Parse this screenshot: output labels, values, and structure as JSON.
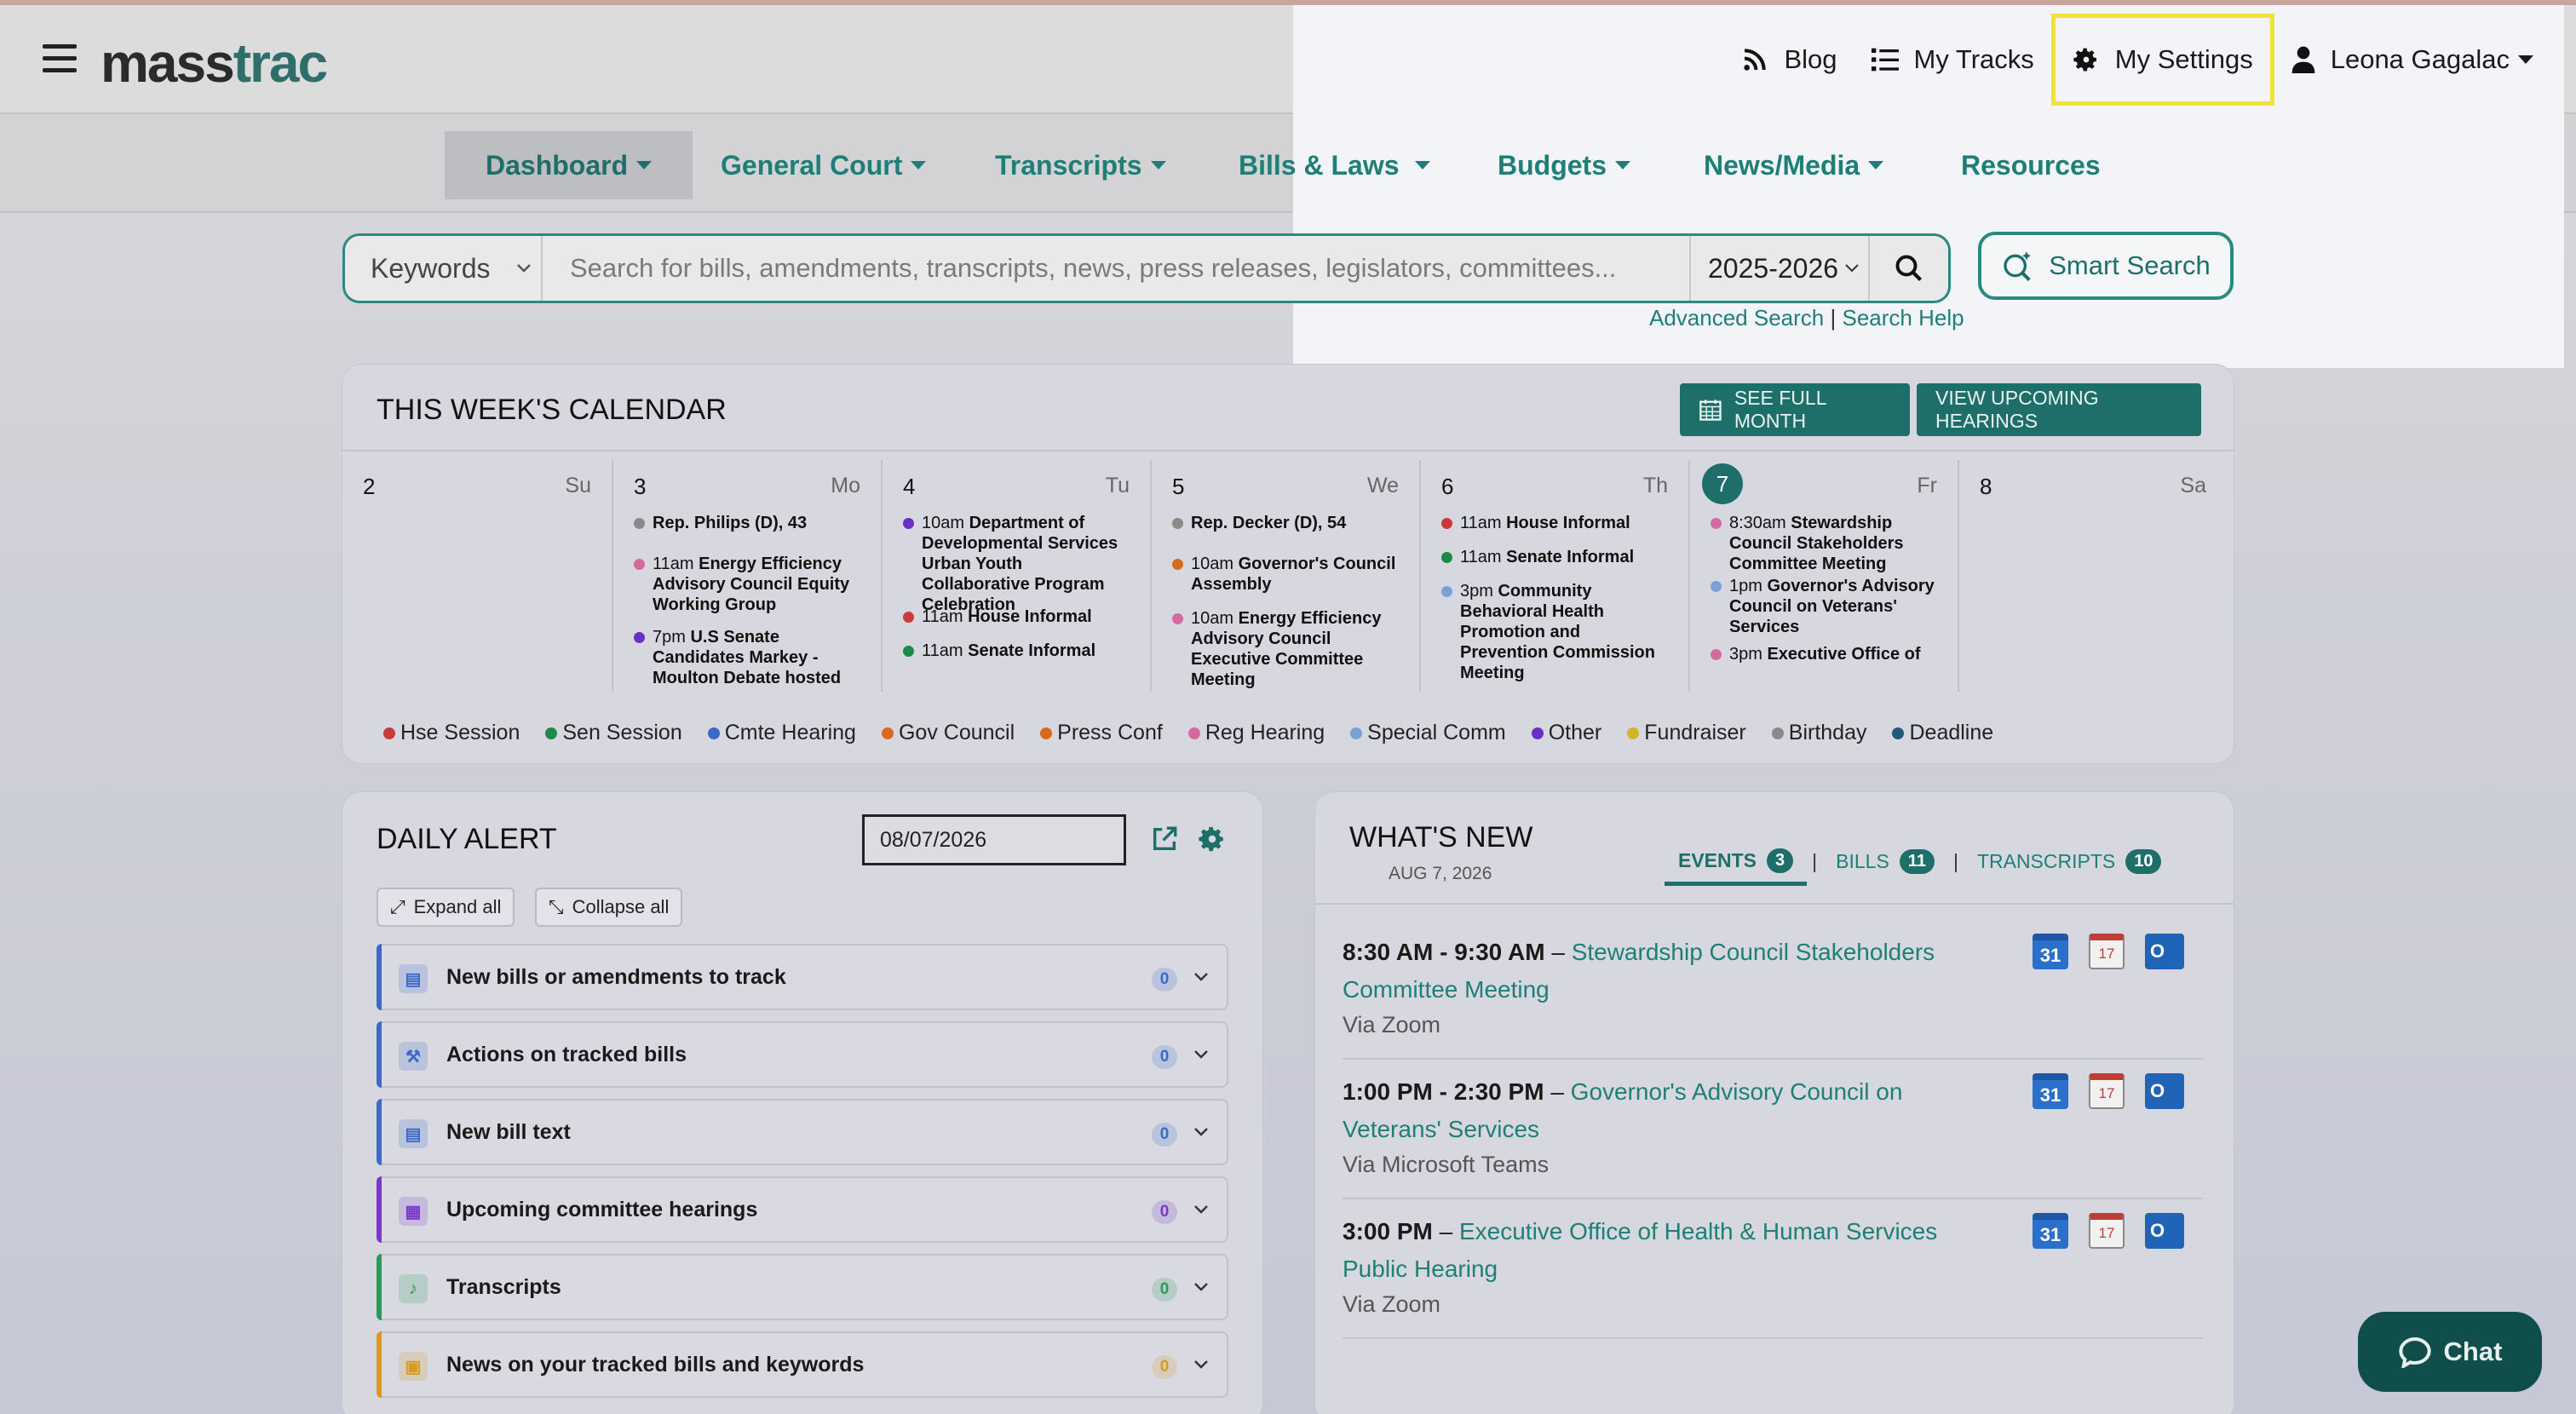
{
  "header": {
    "logo_text": "mass",
    "logo_text_2": "rac",
    "logo_t": "t",
    "nav": {
      "blog": "Blog",
      "my_tracks": "My Tracks",
      "my_settings": "My Settings",
      "user": "Leona Gagalac"
    }
  },
  "main_nav": [
    "Dashboard",
    "General Court",
    "Transcripts",
    "Bills & Laws",
    "Budgets",
    "News/Media",
    "Resources"
  ],
  "search": {
    "type": "Keywords",
    "placeholder": "Search for bills, amendments, transcripts, news, press releases, legislators, committees...",
    "session": "2025-2026",
    "smart_search": "Smart Search",
    "advanced": "Advanced Search",
    "separator": "|",
    "help": "Search Help"
  },
  "calendar": {
    "title": "THIS WEEK'S CALENDAR",
    "see_full_month": "SEE FULL MONTH",
    "view_hearings": "VIEW UPCOMING HEARINGS",
    "days": [
      {
        "num": "2",
        "name": "Su",
        "events": []
      },
      {
        "num": "3",
        "name": "Mo",
        "events": [
          {
            "time": "",
            "title": "Rep. Philips (D), 43",
            "color": "#8a8a8a"
          },
          {
            "time": "11am ",
            "title": "Energy Efficiency Advisory Council Equity Working Group",
            "color": "#d36aa0"
          },
          {
            "time": "7pm ",
            "title": "U.S Senate Candidates Markey - Moulton Debate hosted",
            "color": "#6a2fc4"
          }
        ]
      },
      {
        "num": "4",
        "name": "Tu",
        "events": [
          {
            "time": "10am ",
            "title": "Department of Developmental Services Urban Youth Collaborative Program Celebration",
            "color": "#6a2fc4"
          },
          {
            "time": "11am ",
            "title": "House Informal",
            "color": "#c93a3a"
          },
          {
            "time": "11am ",
            "title": "Senate Informal",
            "color": "#1e8a4a"
          }
        ]
      },
      {
        "num": "5",
        "name": "We",
        "events": [
          {
            "time": "",
            "title": "Rep. Decker (D), 54",
            "color": "#8a8a8a"
          },
          {
            "time": "10am ",
            "title": "Governor's Council Assembly",
            "color": "#d86a1e"
          },
          {
            "time": "10am ",
            "title": "Energy Efficiency Advisory Council Executive Committee Meeting",
            "color": "#d36aa0"
          }
        ]
      },
      {
        "num": "6",
        "name": "Th",
        "events": [
          {
            "time": "11am ",
            "title": "House Informal",
            "color": "#c93a3a"
          },
          {
            "time": "11am ",
            "title": "Senate Informal",
            "color": "#1e8a4a"
          },
          {
            "time": "3pm ",
            "title": "Community Behavioral Health Promotion and Prevention Commission Meeting",
            "color": "#7aa0d8"
          }
        ]
      },
      {
        "num": "7",
        "name": "Fr",
        "events": [
          {
            "time": "8:30am ",
            "title": "Stewardship Council Stakeholders Committee Meeting",
            "color": "#d36aa0"
          },
          {
            "time": "1pm ",
            "title": "Governor's Advisory Council on Veterans' Services",
            "color": "#7aa0d8"
          },
          {
            "time": "3pm ",
            "title": "Executive Office of",
            "color": "#d36aa0"
          }
        ]
      },
      {
        "num": "8",
        "name": "Sa",
        "events": []
      }
    ],
    "legend": [
      {
        "label": "Hse Session",
        "color": "#c93a3a"
      },
      {
        "label": "Sen Session",
        "color": "#1e8a4a"
      },
      {
        "label": "Cmte Hearing",
        "color": "#3a6ac9"
      },
      {
        "label": "Gov Council",
        "color": "#d86a1e"
      },
      {
        "label": "Press Conf",
        "color": "#d86a1e"
      },
      {
        "label": "Reg Hearing",
        "color": "#d36aa0"
      },
      {
        "label": "Special Comm",
        "color": "#7aa0d8"
      },
      {
        "label": "Other",
        "color": "#6a2fc4"
      },
      {
        "label": "Fundraiser",
        "color": "#d4b42a"
      },
      {
        "label": "Birthday",
        "color": "#8a8a8a"
      },
      {
        "label": "Deadline",
        "color": "#1e5a7a"
      }
    ]
  },
  "daily_alert": {
    "title": "DAILY ALERT",
    "date": "08/07/2026",
    "expand_all": "Expand all",
    "collapse_all": "Collapse all",
    "items": [
      {
        "label": "New bills or amendments to track",
        "count": "0",
        "color": "#3a6ac9",
        "icon": "document-plus-icon"
      },
      {
        "label": "Actions on tracked bills",
        "count": "0",
        "color": "#3a6ac9",
        "icon": "gavel-icon"
      },
      {
        "label": "New bill text",
        "count": "0",
        "color": "#3a6ac9",
        "icon": "document-icon"
      },
      {
        "label": "Upcoming committee hearings",
        "count": "0",
        "color": "#7a3ac9",
        "icon": "calendar-icon"
      },
      {
        "label": "Transcripts",
        "count": "0",
        "color": "#2a9a5a",
        "icon": "microphone-icon"
      },
      {
        "label": "News on your tracked bills and keywords",
        "count": "0",
        "color": "#d99a1e",
        "icon": "newspaper-icon"
      }
    ]
  },
  "whats_new": {
    "title": "WHAT'S NEW",
    "date": "AUG 7, 2026",
    "tabs": [
      {
        "label": "EVENTS",
        "count": "3"
      },
      {
        "label": "BILLS",
        "count": "11"
      },
      {
        "label": "TRANSCRIPTS",
        "count": "10"
      }
    ],
    "tab_separator": "|",
    "items": [
      {
        "time": "8:30 AM - 9:30 AM",
        "title": "Stewardship Council Stakeholders Committee Meeting",
        "via": "Via Zoom"
      },
      {
        "time": "1:00 PM - 2:30 PM",
        "title": "Governor's Advisory Council on Veterans' Services",
        "via": "Via Microsoft Teams"
      },
      {
        "time": "3:00 PM",
        "title": "Executive Office of Health & Human Services Public Hearing",
        "via": "Via Zoom"
      }
    ],
    "dash": "–",
    "gcal_text": "31",
    "ical_text": "17",
    "ocal_text": "O"
  },
  "chat": {
    "label": "Chat"
  }
}
